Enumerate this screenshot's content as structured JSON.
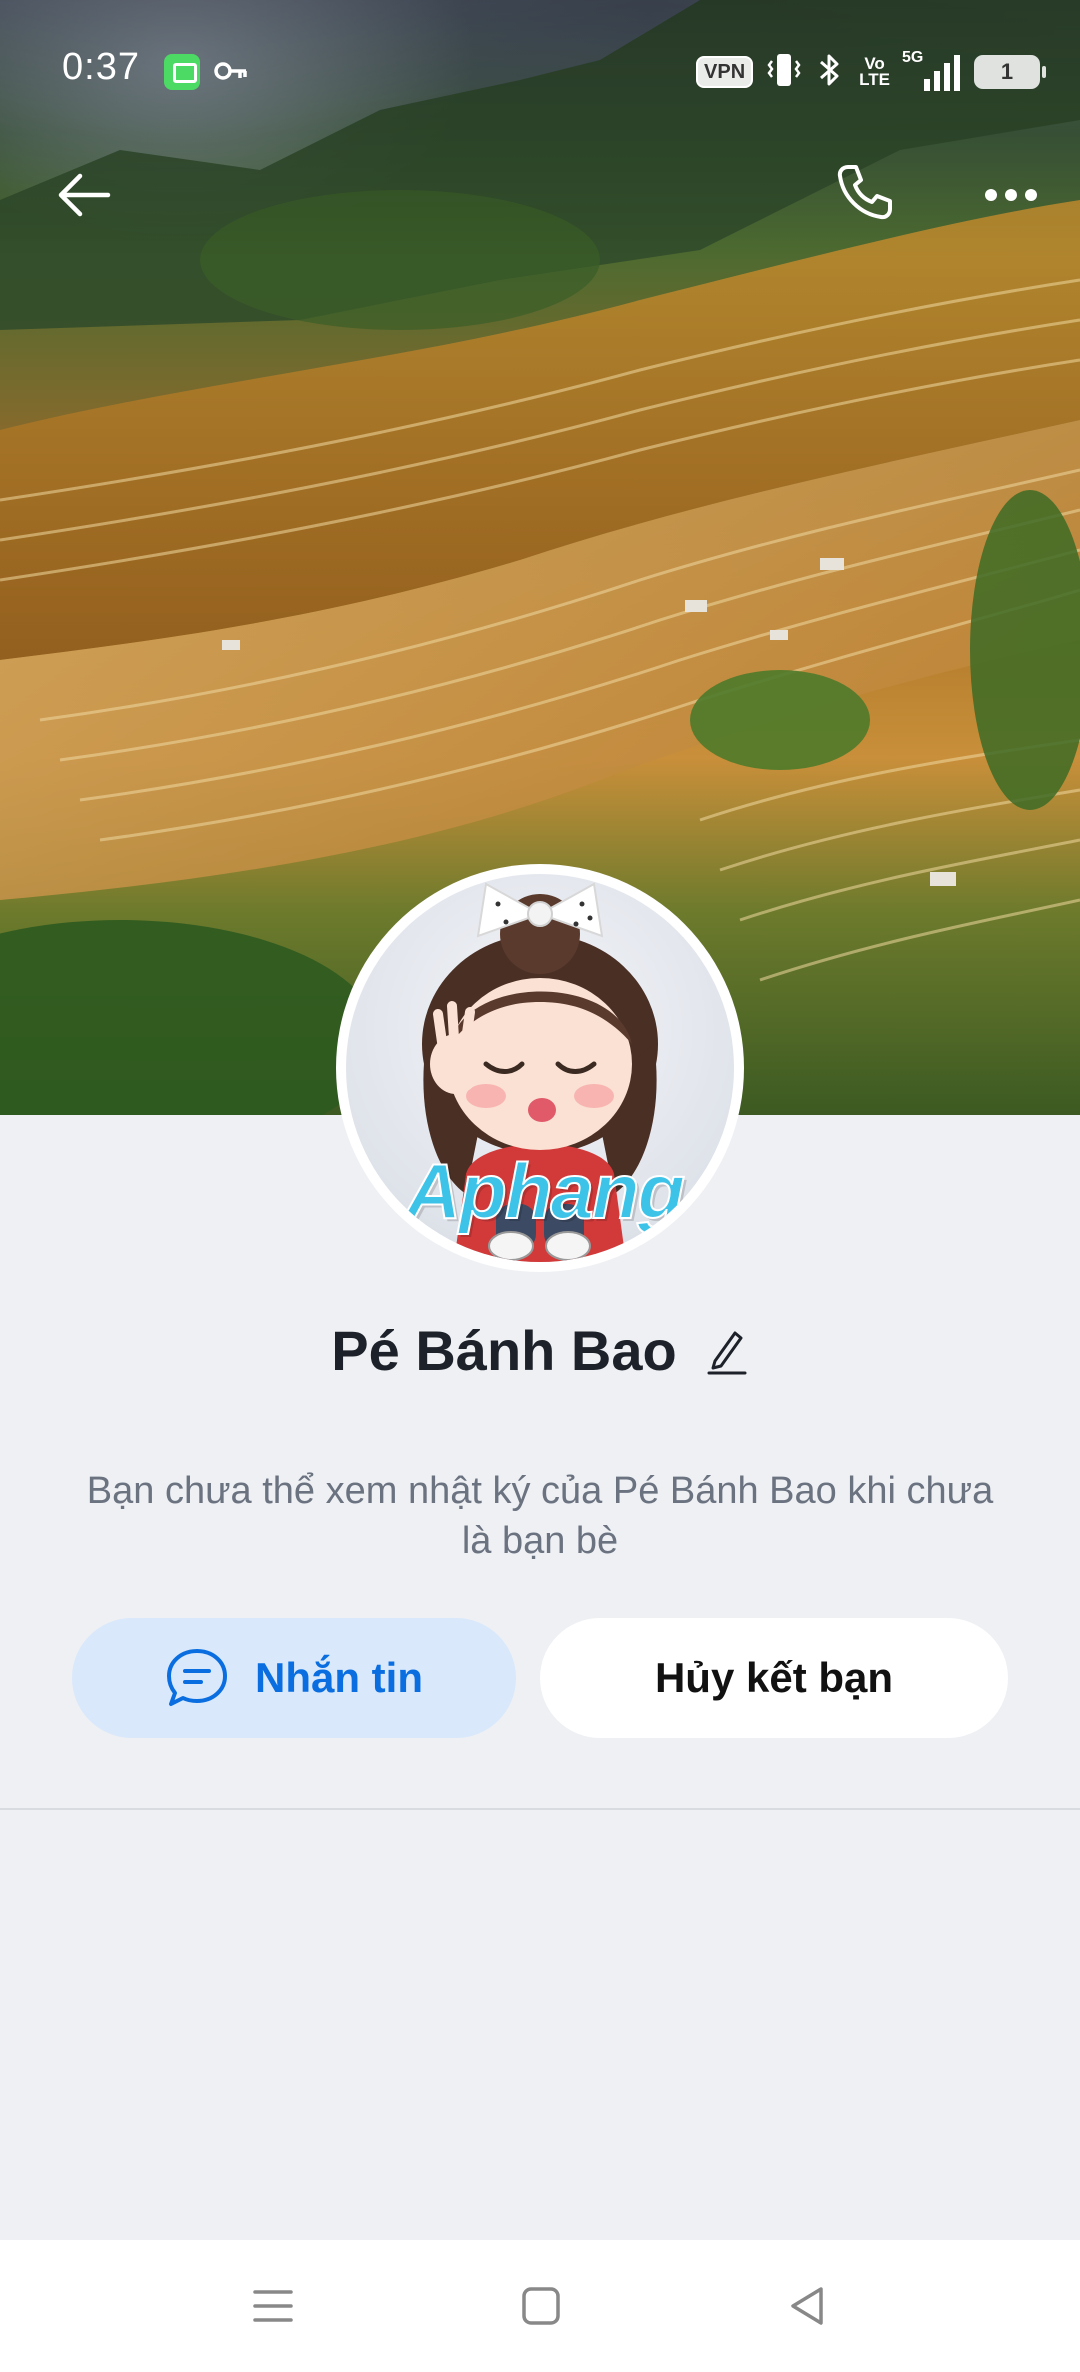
{
  "status_bar": {
    "time": "0:37",
    "vpn": "VPN",
    "volte_top": "Vo",
    "volte_bottom": "LTE",
    "network": "5G",
    "battery": "1"
  },
  "profile": {
    "name": "Pé Bánh Bao",
    "watermark": "Aphang",
    "notice": "Bạn chưa thể xem nhật ký của Pé Bánh Bao khi chưa là bạn bè"
  },
  "actions": {
    "message_label": "Nhắn tin",
    "unfriend_label": "Hủy kết bạn"
  },
  "icons": {
    "back": "arrow-left-icon",
    "call": "phone-icon",
    "more": "more-horizontal-icon",
    "edit": "pencil-icon",
    "message": "chat-bubble-icon"
  },
  "colors": {
    "accent": "#0a6ee0",
    "message_button_bg": "#d9e8fb",
    "page_bg": "#eef0f4"
  }
}
